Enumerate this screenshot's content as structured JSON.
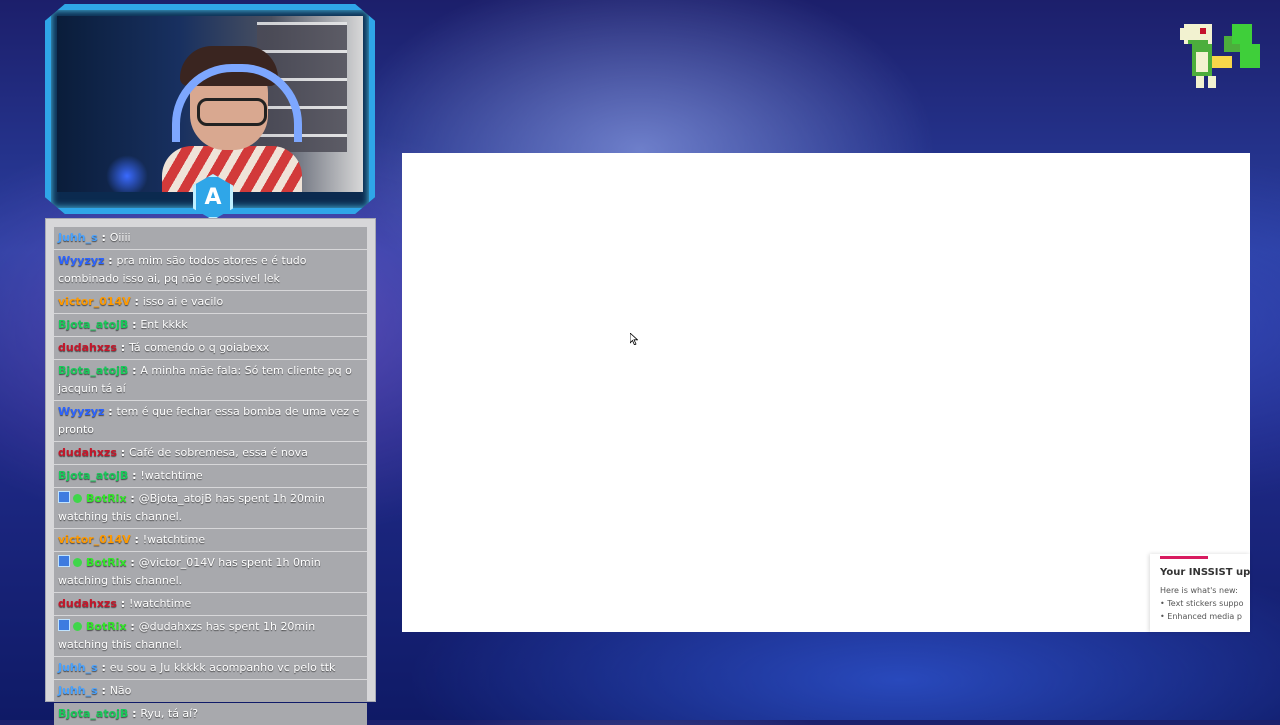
{
  "stream": {
    "badge_letter": "A",
    "accent_color": "#2fa6e8"
  },
  "chat": {
    "messages": [
      {
        "user": "Juhh_s",
        "user_color": "#4aa3ff",
        "text": "Oiiii"
      },
      {
        "user": "Wyyzyz",
        "user_color": "#2b63ff",
        "text": "pra mim são todos atores e é tudo combinado isso ai, pq não é possivel lek"
      },
      {
        "user": "victor_014V",
        "user_color": "#ff9a00",
        "text": "isso ai e vacilo"
      },
      {
        "user": "Bjota_atojB",
        "user_color": "#19c95a",
        "text": "Ent kkkk"
      },
      {
        "user": "dudahxzs",
        "user_color": "#c5162a",
        "text": "Tá comendo o q goiabexx"
      },
      {
        "user": "Bjota_atojB",
        "user_color": "#19c95a",
        "text": "A minha mãe fala: Só tem cliente pq o jacquin tá aí"
      },
      {
        "user": "Wyyzyz",
        "user_color": "#2b63ff",
        "text": "tem é que fechar essa bomba de uma vez e pronto"
      },
      {
        "user": "dudahxzs",
        "user_color": "#c5162a",
        "text": "Café de sobremesa, essa é nova"
      },
      {
        "user": "Bjota_atojB",
        "user_color": "#19c95a",
        "text": "!watchtime"
      },
      {
        "user": "BotRix",
        "user_color": "#33e62b",
        "bot": true,
        "text": "@Bjota_atojB has spent 1h 20min watching this channel."
      },
      {
        "user": "victor_014V",
        "user_color": "#ff9a00",
        "text": "!watchtime"
      },
      {
        "user": "BotRix",
        "user_color": "#33e62b",
        "bot": true,
        "text": "@victor_014V has spent 1h 0min watching this channel."
      },
      {
        "user": "dudahxzs",
        "user_color": "#c5162a",
        "text": "!watchtime"
      },
      {
        "user": "BotRix",
        "user_color": "#33e62b",
        "bot": true,
        "text": "@dudahxzs has spent 1h 20min watching this channel."
      },
      {
        "user": "Juhh_s",
        "user_color": "#4aa3ff",
        "text": "eu sou a Ju kkkkk acompanho vc pelo ttk"
      },
      {
        "user": "Juhh_s",
        "user_color": "#4aa3ff",
        "text": "Não"
      },
      {
        "user": "Bjota_atojB",
        "user_color": "#19c95a",
        "text": "Ryu, tá aí?"
      }
    ]
  },
  "notice": {
    "title": "Your INSSIST upgr",
    "subtitle": "Here is what's new:",
    "items": [
      "• Text stickers suppo",
      "• Enhanced media p"
    ]
  }
}
